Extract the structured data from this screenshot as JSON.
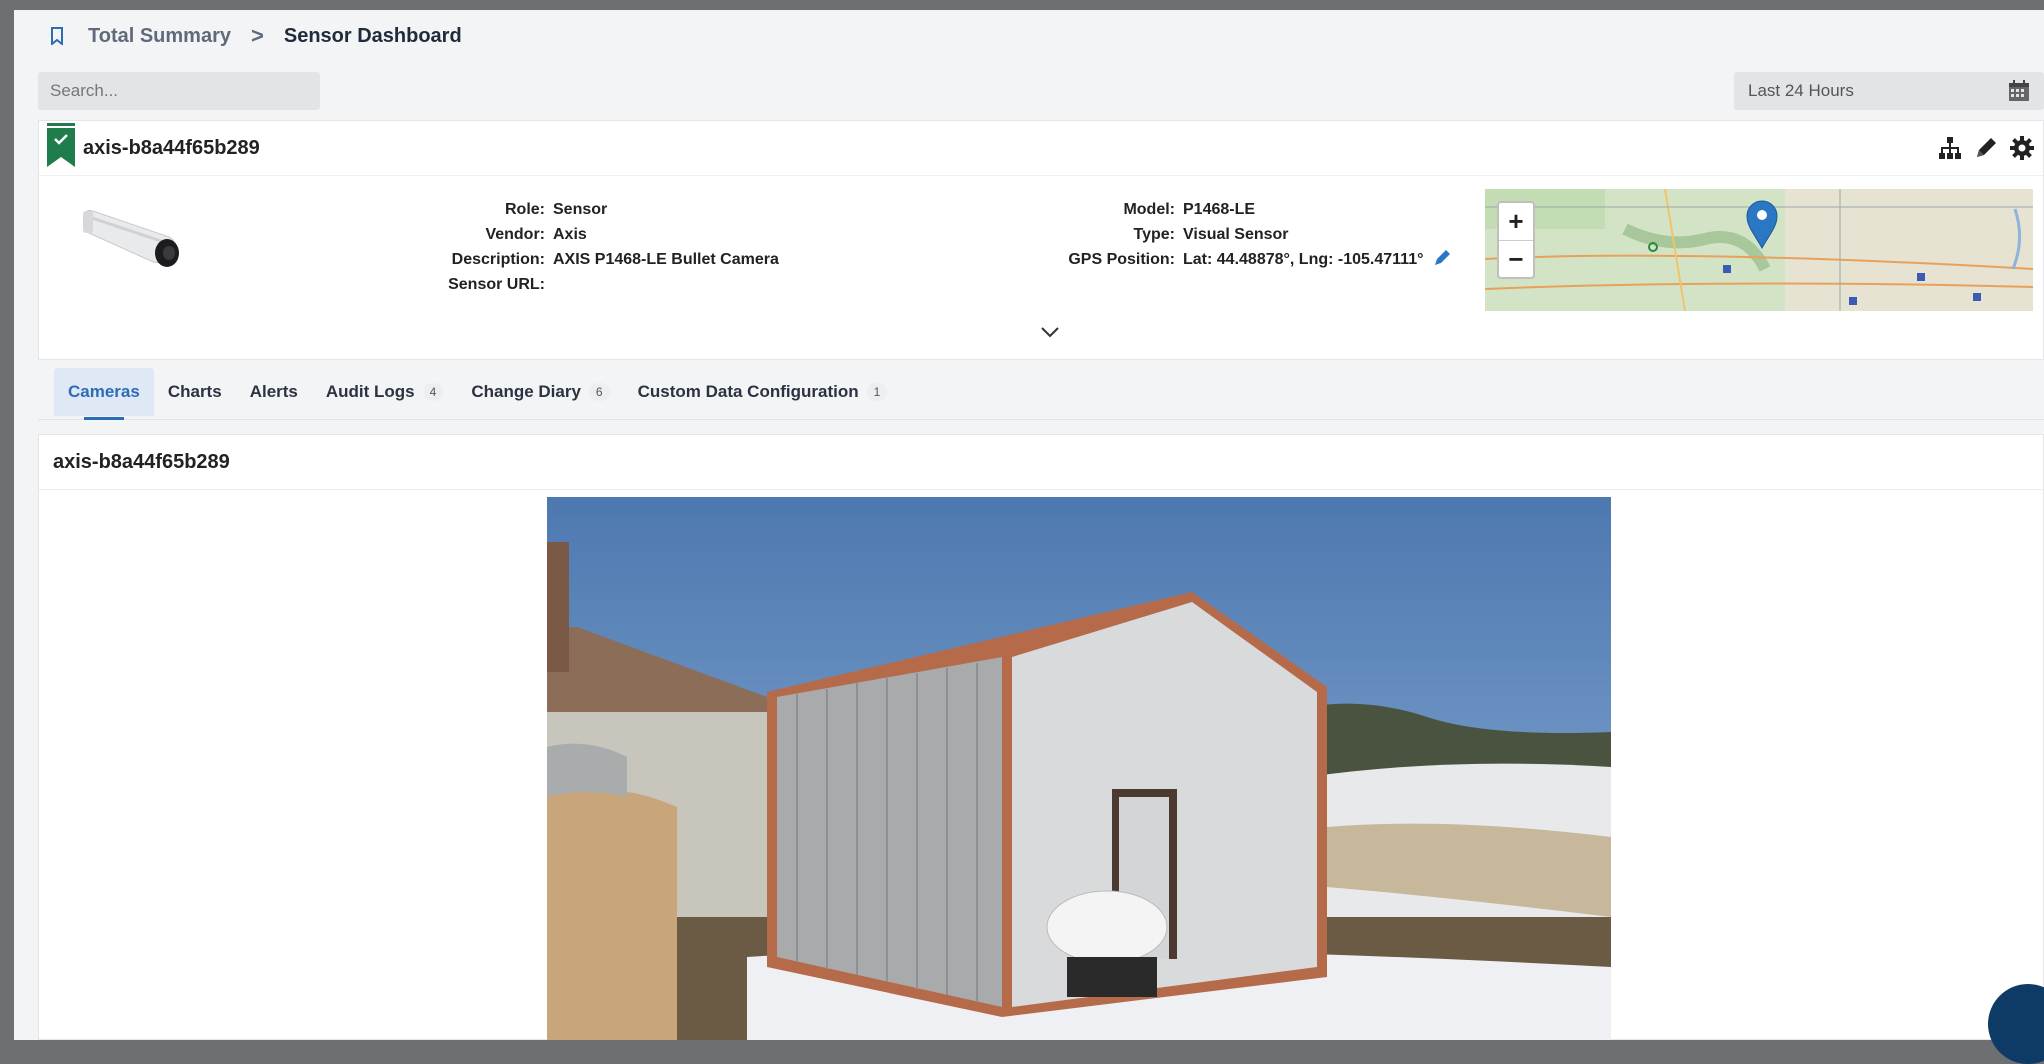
{
  "breadcrumb": {
    "icon": "bookmark-icon",
    "parent": "Total Summary",
    "separator": ">",
    "current": "Sensor Dashboard"
  },
  "search": {
    "placeholder": "Search..."
  },
  "time_range": {
    "label": "Last 24 Hours",
    "icon": "calendar-icon"
  },
  "sensor": {
    "title": "axis-b8a44f65b289",
    "status_icon": "check-flag-icon",
    "actions": [
      "hierarchy-icon",
      "pencil-icon",
      "gear-icon"
    ],
    "details_left": [
      {
        "key": "Role:",
        "value": "Sensor"
      },
      {
        "key": "Vendor:",
        "value": "Axis"
      },
      {
        "key": "Description:",
        "value": "AXIS P1468-LE Bullet Camera"
      },
      {
        "key": "Sensor URL:",
        "value": ""
      }
    ],
    "details_right": [
      {
        "key": "Model:",
        "value": "P1468-LE"
      },
      {
        "key": "Type:",
        "value": "Visual Sensor"
      },
      {
        "key": "GPS Position:",
        "value": "Lat:  44.48878°, Lng:  -105.47111°"
      }
    ],
    "map": {
      "zoom_in": "+",
      "zoom_out": "−"
    }
  },
  "tabs": [
    {
      "label": "Cameras",
      "badge": "",
      "active": true
    },
    {
      "label": "Charts",
      "badge": ""
    },
    {
      "label": "Alerts",
      "badge": ""
    },
    {
      "label": "Audit Logs",
      "badge": "4"
    },
    {
      "label": "Change Diary",
      "badge": "6"
    },
    {
      "label": "Custom Data Configuration",
      "badge": "1"
    }
  ],
  "camera_panel": {
    "title": "axis-b8a44f65b289"
  },
  "colors": {
    "accent": "#2d6db5",
    "flag_green": "#1e7d4a",
    "pin_blue": "#2a78c4"
  }
}
